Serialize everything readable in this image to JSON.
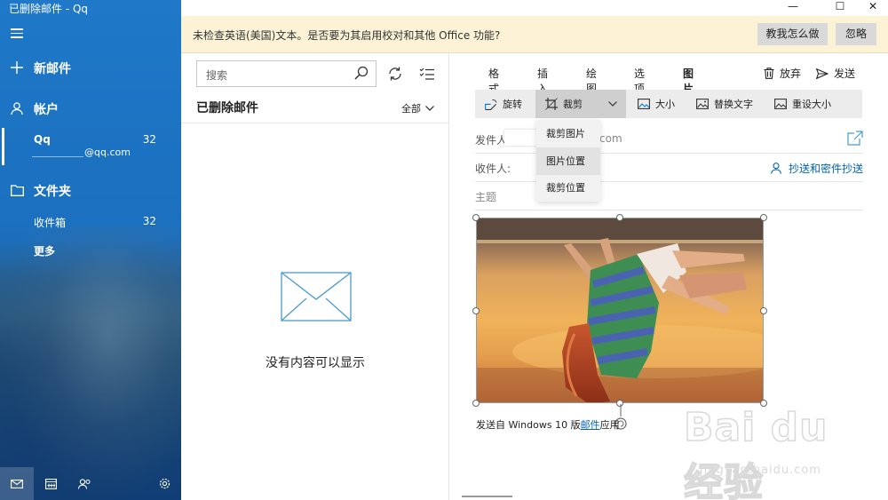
{
  "window": {
    "title": "已删除邮件 - Qq",
    "controls": {
      "minimize": "—",
      "maximize": "☐",
      "close": "✕"
    }
  },
  "sidebar": {
    "new_mail": "新邮件",
    "accounts_heading": "帐户",
    "account": {
      "name": "Qq",
      "email": "@qq.com",
      "count": "32"
    },
    "folders_heading": "文件夹",
    "folders": [
      {
        "label": "收件箱",
        "count": "32"
      },
      {
        "label": "更多",
        "count": ""
      }
    ]
  },
  "infobar": {
    "message": "未检查英语(美国)文本。是否要为其启用校对和其他 Office 功能?",
    "teach_button": "教我怎么做",
    "ignore_button": "忽略"
  },
  "list": {
    "search_placeholder": "搜索",
    "folder_title": "已删除邮件",
    "filter": "全部",
    "empty_message": "没有内容可以显示"
  },
  "compose": {
    "tabs": [
      "格式",
      "插入",
      "绘图",
      "选项",
      "图片"
    ],
    "active_tab": "图片",
    "discard": "放弃",
    "send": "发送",
    "toolbar": {
      "rotate": "旋转",
      "crop": "裁剪",
      "size": "大小",
      "alt_text": "替换文字",
      "reset_size": "重设大小"
    },
    "crop_menu": [
      "裁剪图片",
      "图片位置",
      "裁剪位置"
    ],
    "from_label": "发件人",
    "from_value": "com",
    "to_label": "收件人:",
    "cc_label": "抄送和密件抄送",
    "subject_label": "主题",
    "signature_prefix": "发送自 Windows 10 版",
    "signature_link": "邮件",
    "signature_suffix": "应用"
  },
  "watermark": {
    "brand": "Bai du 经验",
    "url": "jingyan.baidu.com"
  },
  "colors": {
    "accent": "#0078d4",
    "sidebar": "#1b6fbe",
    "infobar": "#fcf3d7"
  }
}
